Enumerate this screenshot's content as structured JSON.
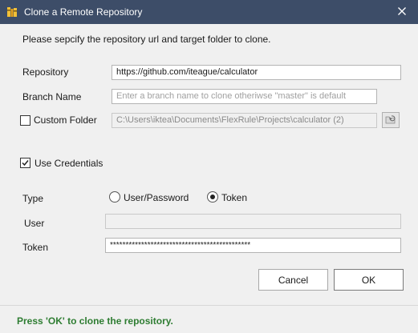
{
  "window": {
    "title": "Clone a Remote Repository",
    "close_icon": "close-icon",
    "app_icon": "repository-app-icon"
  },
  "instruction": "Please sepcify the repository url and target folder to clone.",
  "repository": {
    "label": "Repository",
    "value": "https://github.com/iteague/calculator"
  },
  "branch": {
    "label": "Branch Name",
    "value": "",
    "placeholder": "Enter a branch name to clone otheriwse \"master\" is default"
  },
  "custom_folder": {
    "label": "Custom Folder",
    "checked": false,
    "value": "C:\\Users\\iktea\\Documents\\FlexRule\\Projects\\calculator (2)",
    "browse_icon": "folder-browse-icon"
  },
  "use_credentials": {
    "label": "Use Credentials",
    "checked": true
  },
  "type": {
    "label": "Type",
    "options": [
      "User/Password",
      "Token"
    ],
    "selected": "Token"
  },
  "user": {
    "label": "User",
    "value": ""
  },
  "token": {
    "label": "Token",
    "value": "*********************************************"
  },
  "buttons": {
    "cancel": "Cancel",
    "ok": "OK"
  },
  "status": {
    "message": "Press 'OK' to clone the repository.",
    "color": "#2e7d32"
  },
  "colors": {
    "titlebar": "#3d4d68",
    "dialog_bg": "#f0f0f0"
  }
}
